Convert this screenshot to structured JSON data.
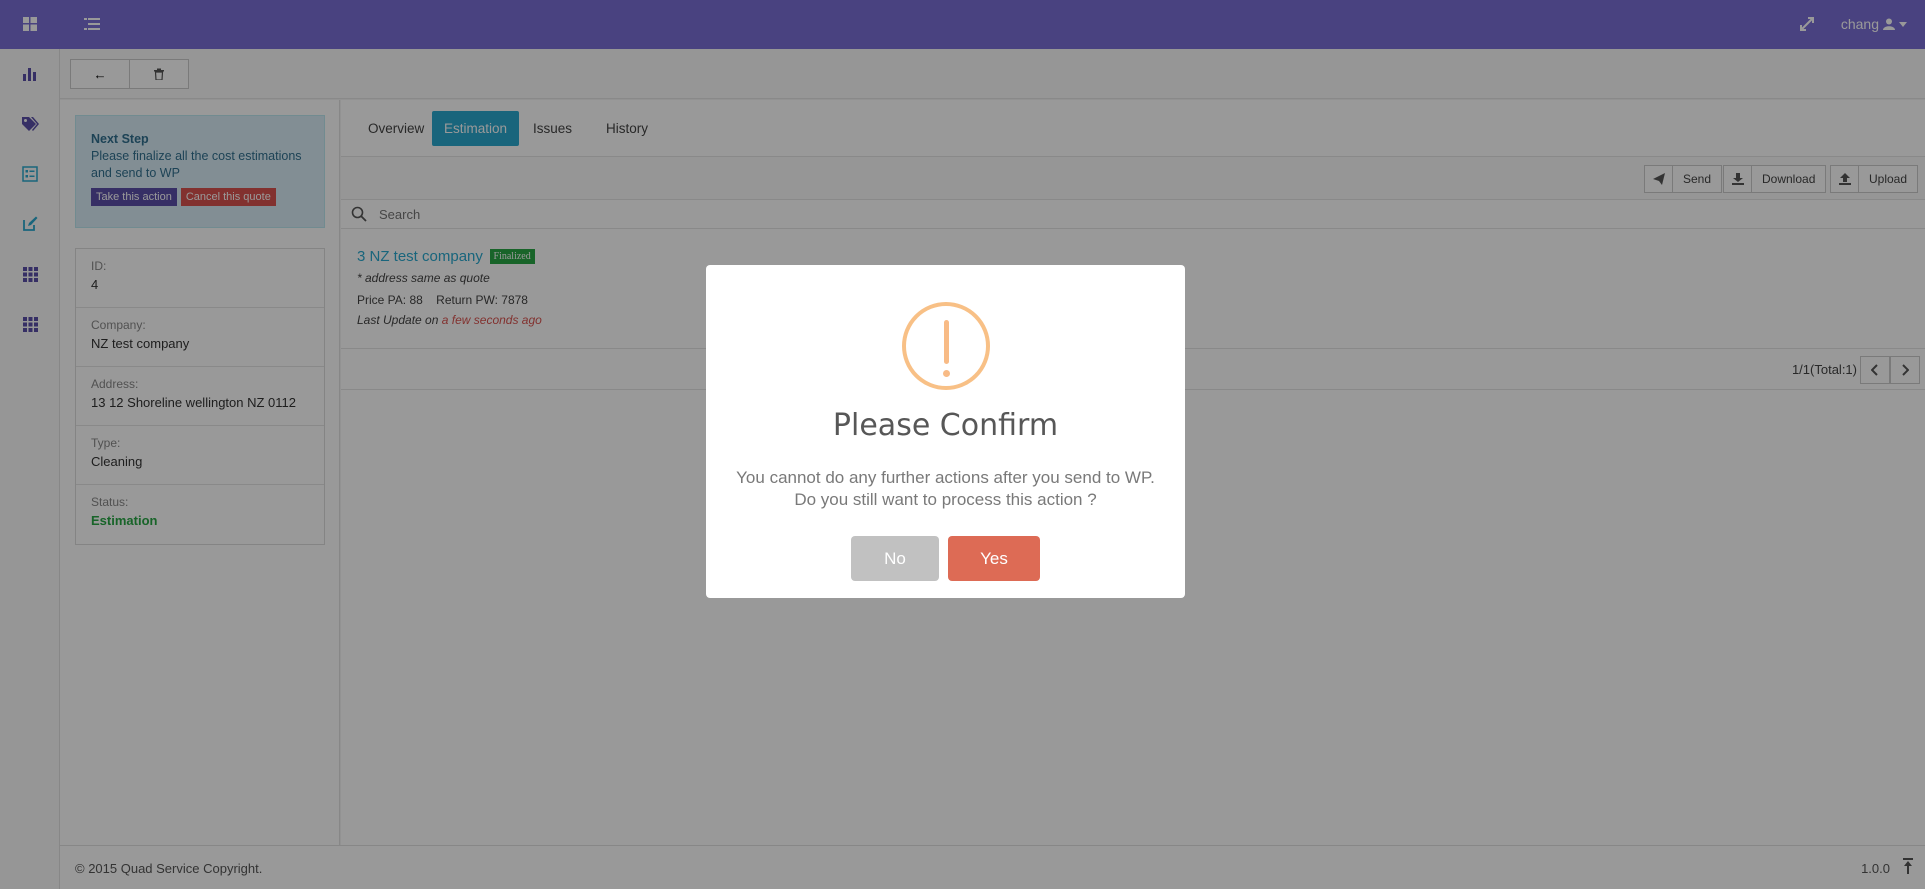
{
  "header": {
    "user": "chang"
  },
  "toolbar": {
    "back_label": "←"
  },
  "next_step": {
    "title": "Next Step",
    "text": "Please finalize all the cost estimations and send to WP",
    "action_label": "Take this action",
    "cancel_label": "Cancel this quote"
  },
  "details": [
    {
      "label": "ID:",
      "value": "4"
    },
    {
      "label": "Company:",
      "value": "NZ test company"
    },
    {
      "label": "Address:",
      "value": "13 12 Shoreline wellington NZ 0112"
    },
    {
      "label": "Type:",
      "value": "Cleaning"
    },
    {
      "label": "Status:",
      "value": "Estimation"
    }
  ],
  "tabs": [
    "Overview",
    "Estimation",
    "Issues",
    "History"
  ],
  "actions": {
    "send": "Send",
    "download": "Download",
    "upload": "Upload"
  },
  "search": {
    "placeholder": "Search"
  },
  "item": {
    "name": "3 NZ test company",
    "badge": "Finalized",
    "address": "* address same as quote",
    "price": "Price PA: 88",
    "return": "Return PW: 7878",
    "update_prefix": "Last Update on",
    "update_time": "a few seconds ago"
  },
  "pager": {
    "total": "1/1(Total:1)"
  },
  "footer": {
    "copyright": "© 2015 Quad Service Copyright.",
    "version": "1.0.0"
  },
  "modal": {
    "title": "Please Confirm",
    "message": "You cannot do any further actions after you send to WP. Do you still want to process this action ?",
    "no_label": "No",
    "yes_label": "Yes"
  },
  "colors": {
    "topbar": "#7b6fd6",
    "accent": "#2aa9cf",
    "success": "#28a745",
    "danger": "#d9534f",
    "confirm": "#dd6b55",
    "warning": "#f8bb86"
  }
}
